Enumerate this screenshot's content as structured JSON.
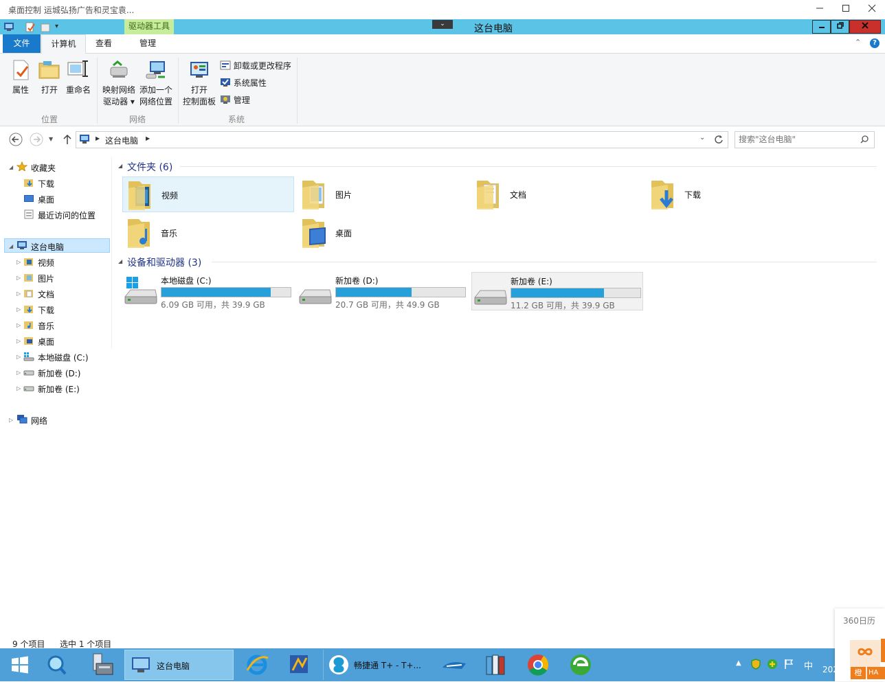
{
  "outer_window": {
    "title": "桌面控制  运城弘扬广告和灵宝袁..."
  },
  "explorer": {
    "title": "这台电脑",
    "contextual_tab": "驱动器工具",
    "tabs": {
      "file": "文件",
      "computer": "计算机",
      "view": "查看",
      "manage": "管理"
    }
  },
  "ribbon": {
    "location": {
      "label": "位置",
      "properties": "属性",
      "open": "打开",
      "rename": "重命名"
    },
    "network": {
      "label": "网络",
      "map_drive_1": "映射网络",
      "map_drive_2": "驱动器 ▾",
      "add_location_1": "添加一个",
      "add_location_2": "网络位置"
    },
    "system": {
      "label": "系统",
      "open_cp_1": "打开",
      "open_cp_2": "控制面板",
      "uninstall": "卸载或更改程序",
      "sys_props": "系统属性",
      "manage": "管理"
    }
  },
  "address": {
    "path": "这台电脑",
    "search_placeholder": "搜索\"这台电脑\""
  },
  "nav": {
    "favorites": "收藏夹",
    "fav_items": [
      "下载",
      "桌面",
      "最近访问的位置"
    ],
    "this_pc": "这台电脑",
    "pc_items": [
      "视频",
      "图片",
      "文档",
      "下载",
      "音乐",
      "桌面",
      "本地磁盘 (C:)",
      "新加卷 (D:)",
      "新加卷 (E:)"
    ],
    "network": "网络"
  },
  "content": {
    "folders_header": "文件夹 (6)",
    "folders": [
      "视频",
      "图片",
      "文档",
      "下载",
      "音乐",
      "桌面"
    ],
    "drives_header": "设备和驱动器 (3)",
    "drives": [
      {
        "name": "本地磁盘 (C:)",
        "free": "6.09 GB 可用，共 39.9 GB",
        "used_fraction": 0.847
      },
      {
        "name": "新加卷 (D:)",
        "free": "20.7 GB 可用，共 49.9 GB",
        "used_fraction": 0.585
      },
      {
        "name": "新加卷 (E:)",
        "free": "11.2 GB 可用，共 39.9 GB",
        "used_fraction": 0.719
      }
    ]
  },
  "status": {
    "count": "9 个项目",
    "selected": "选中 1 个项目"
  },
  "taskbar": {
    "explorer": "这台电脑",
    "chanjet": "畅捷通 T+ - T+...",
    "ime": "中",
    "clock": "202"
  },
  "widget": {
    "title": "360日历",
    "badge_1": "橙",
    "badge_2": "HA"
  },
  "colors": {
    "accent": "#1979ca",
    "titlebar": "#5bc4e6",
    "drive_tools": "#c7ec9c",
    "taskbar": "#4f9fd8",
    "bar_fill": "#26a0da"
  }
}
